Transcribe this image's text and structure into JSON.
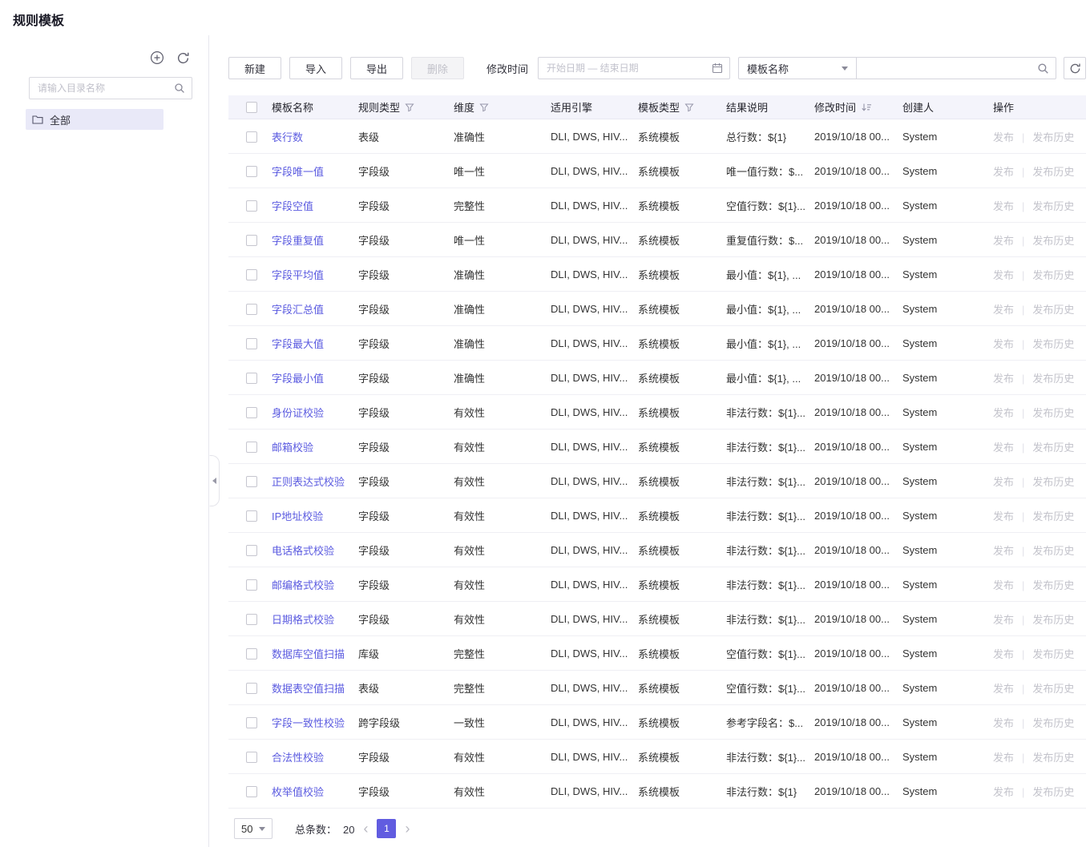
{
  "page": {
    "title": "规则模板"
  },
  "icons": {
    "prev": "‹",
    "next": "›",
    "separator": "|",
    "names": [
      "add-circle-icon",
      "refresh-icon",
      "search-icon",
      "folder-icon",
      "calendar-icon",
      "caret-down-icon",
      "filter-icon",
      "sort-icon",
      "collapse-icon",
      "checkbox"
    ]
  },
  "sidebar": {
    "search_placeholder": "请输入目录名称",
    "tree": [
      {
        "label": "全部"
      }
    ]
  },
  "toolbar": {
    "new": "新建",
    "import": "导入",
    "export": "导出",
    "delete": "删除",
    "modified_time_label": "修改时间",
    "date_placeholder": "开始日期 — 结束日期",
    "name_filter_value": "模板名称"
  },
  "table": {
    "columns": [
      "模板名称",
      "规则类型",
      "维度",
      "适用引擎",
      "模板类型",
      "结果说明",
      "修改时间",
      "创建人",
      "操作"
    ],
    "actions": {
      "publish": "发布",
      "history": "发布历史"
    },
    "rows": [
      {
        "name": "表行数",
        "rule_type": "表级",
        "dimension": "准确性",
        "engine": "DLI, DWS, HIV...",
        "template_type": "系统模板",
        "result": "总行数：${1}",
        "modified": "2019/10/18 00...",
        "creator": "System"
      },
      {
        "name": "字段唯一值",
        "rule_type": "字段级",
        "dimension": "唯一性",
        "engine": "DLI, DWS, HIV...",
        "template_type": "系统模板",
        "result": "唯一值行数：$...",
        "modified": "2019/10/18 00...",
        "creator": "System"
      },
      {
        "name": "字段空值",
        "rule_type": "字段级",
        "dimension": "完整性",
        "engine": "DLI, DWS, HIV...",
        "template_type": "系统模板",
        "result": "空值行数：${1}...",
        "modified": "2019/10/18 00...",
        "creator": "System"
      },
      {
        "name": "字段重复值",
        "rule_type": "字段级",
        "dimension": "唯一性",
        "engine": "DLI, DWS, HIV...",
        "template_type": "系统模板",
        "result": "重复值行数：$...",
        "modified": "2019/10/18 00...",
        "creator": "System"
      },
      {
        "name": "字段平均值",
        "rule_type": "字段级",
        "dimension": "准确性",
        "engine": "DLI, DWS, HIV...",
        "template_type": "系统模板",
        "result": "最小值：${1}, ...",
        "modified": "2019/10/18 00...",
        "creator": "System"
      },
      {
        "name": "字段汇总值",
        "rule_type": "字段级",
        "dimension": "准确性",
        "engine": "DLI, DWS, HIV...",
        "template_type": "系统模板",
        "result": "最小值：${1}, ...",
        "modified": "2019/10/18 00...",
        "creator": "System"
      },
      {
        "name": "字段最大值",
        "rule_type": "字段级",
        "dimension": "准确性",
        "engine": "DLI, DWS, HIV...",
        "template_type": "系统模板",
        "result": "最小值：${1}, ...",
        "modified": "2019/10/18 00...",
        "creator": "System"
      },
      {
        "name": "字段最小值",
        "rule_type": "字段级",
        "dimension": "准确性",
        "engine": "DLI, DWS, HIV...",
        "template_type": "系统模板",
        "result": "最小值：${1}, ...",
        "modified": "2019/10/18 00...",
        "creator": "System"
      },
      {
        "name": "身份证校验",
        "rule_type": "字段级",
        "dimension": "有效性",
        "engine": "DLI, DWS, HIV...",
        "template_type": "系统模板",
        "result": "非法行数：${1}...",
        "modified": "2019/10/18 00...",
        "creator": "System"
      },
      {
        "name": "邮箱校验",
        "rule_type": "字段级",
        "dimension": "有效性",
        "engine": "DLI, DWS, HIV...",
        "template_type": "系统模板",
        "result": "非法行数：${1}...",
        "modified": "2019/10/18 00...",
        "creator": "System"
      },
      {
        "name": "正则表达式校验",
        "rule_type": "字段级",
        "dimension": "有效性",
        "engine": "DLI, DWS, HIV...",
        "template_type": "系统模板",
        "result": "非法行数：${1}...",
        "modified": "2019/10/18 00...",
        "creator": "System"
      },
      {
        "name": "IP地址校验",
        "rule_type": "字段级",
        "dimension": "有效性",
        "engine": "DLI, DWS, HIV...",
        "template_type": "系统模板",
        "result": "非法行数：${1}...",
        "modified": "2019/10/18 00...",
        "creator": "System"
      },
      {
        "name": "电话格式校验",
        "rule_type": "字段级",
        "dimension": "有效性",
        "engine": "DLI, DWS, HIV...",
        "template_type": "系统模板",
        "result": "非法行数：${1}...",
        "modified": "2019/10/18 00...",
        "creator": "System"
      },
      {
        "name": "邮编格式校验",
        "rule_type": "字段级",
        "dimension": "有效性",
        "engine": "DLI, DWS, HIV...",
        "template_type": "系统模板",
        "result": "非法行数：${1}...",
        "modified": "2019/10/18 00...",
        "creator": "System"
      },
      {
        "name": "日期格式校验",
        "rule_type": "字段级",
        "dimension": "有效性",
        "engine": "DLI, DWS, HIV...",
        "template_type": "系统模板",
        "result": "非法行数：${1}...",
        "modified": "2019/10/18 00...",
        "creator": "System"
      },
      {
        "name": "数据库空值扫描",
        "rule_type": "库级",
        "dimension": "完整性",
        "engine": "DLI, DWS, HIV...",
        "template_type": "系统模板",
        "result": "空值行数：${1}...",
        "modified": "2019/10/18 00...",
        "creator": "System"
      },
      {
        "name": "数据表空值扫描",
        "rule_type": "表级",
        "dimension": "完整性",
        "engine": "DLI, DWS, HIV...",
        "template_type": "系统模板",
        "result": "空值行数：${1}...",
        "modified": "2019/10/18 00...",
        "creator": "System"
      },
      {
        "name": "字段一致性校验",
        "rule_type": "跨字段级",
        "dimension": "一致性",
        "engine": "DLI, DWS, HIV...",
        "template_type": "系统模板",
        "result": "参考字段名：$...",
        "modified": "2019/10/18 00...",
        "creator": "System"
      },
      {
        "name": "合法性校验",
        "rule_type": "字段级",
        "dimension": "有效性",
        "engine": "DLI, DWS, HIV...",
        "template_type": "系统模板",
        "result": "非法行数：${1}...",
        "modified": "2019/10/18 00...",
        "creator": "System"
      },
      {
        "name": "枚举值校验",
        "rule_type": "字段级",
        "dimension": "有效性",
        "engine": "DLI, DWS, HIV...",
        "template_type": "系统模板",
        "result": "非法行数：${1}",
        "modified": "2019/10/18 00...",
        "creator": "System"
      }
    ]
  },
  "pagination": {
    "page_size": "50",
    "total_label": "总条数：",
    "total": "20",
    "current_page": "1"
  }
}
